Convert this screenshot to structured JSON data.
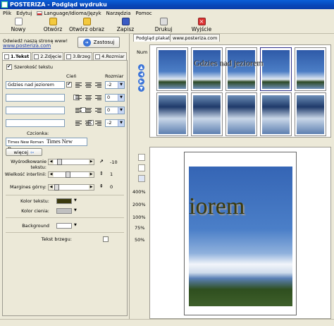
{
  "window": {
    "title": "POSTERIZA - Podgląd wydruku"
  },
  "menu": {
    "items": [
      {
        "label": "Plik"
      },
      {
        "label": "Edytuj"
      },
      {
        "label": "Language/Idioma/Język"
      },
      {
        "label": "Narzędzia"
      },
      {
        "label": "Pomoc"
      }
    ]
  },
  "toolbar": {
    "new": "Nowy",
    "open": "Otwórz",
    "open_image": "Otwórz obraz",
    "save": "Zapisz",
    "print": "Drukuj",
    "exit": "Wyjście"
  },
  "sidebar": {
    "visit_text": "Odwiedź naszą stronę www!",
    "visit_link": "www.posteriza.com",
    "apply": "Zastosuj",
    "tabs": [
      "1.Tekst",
      "2.Zdjęcie",
      "3.Brzeg",
      "4.Rozmiar"
    ],
    "text_width_label": "Szerokość tekstu",
    "col_shadow": "Cień",
    "col_size": "Rozmiar",
    "text_rows": [
      {
        "value": "Gdzies nad jeziorem",
        "shadow": true,
        "size": "-2"
      },
      {
        "value": "",
        "shadow": false,
        "size": "0"
      },
      {
        "value": "",
        "shadow": false,
        "size": "0"
      },
      {
        "value": "",
        "shadow": false,
        "size": "-2"
      }
    ],
    "font_label": "Czcionka:",
    "font_value": "Times New Roman",
    "font_preview": "Times New Roman",
    "more_btn": "więcej",
    "align_label": "Wyśrodkowanie tekstu:",
    "align_value": "-10",
    "spacing_label": "Wielkość interlinii:",
    "spacing_value": "1",
    "margin_label": "Margines górny:",
    "margin_value": "0",
    "text_color_label": "Kolor tekstu:",
    "shadow_color_label": "Kolor cienia:",
    "background_label": "Background",
    "edge_text_label": "Tekst brzegu:",
    "colors": {
      "text": "#3b3a0e",
      "shadow": "#c0c0c0",
      "background": "#ffffff"
    }
  },
  "preview": {
    "tabs": [
      "Podgląd plakatu",
      "www.posteriza.com"
    ],
    "num_label": "Num",
    "poster_text": "Gdzies nad jeziorem",
    "page_text": "iorem",
    "zoom_levels": [
      "400%",
      "200%",
      "100%",
      "75%",
      "50%"
    ]
  }
}
